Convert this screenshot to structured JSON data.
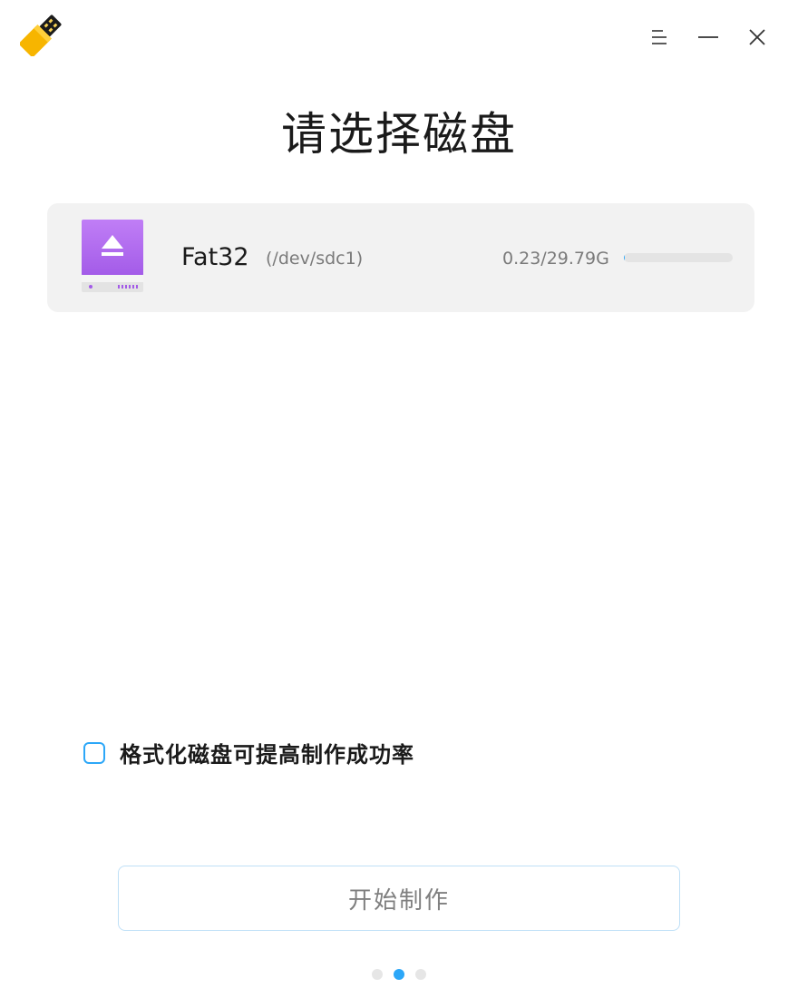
{
  "window": {
    "controls": {
      "menu_icon": "menu-icon",
      "minimize_icon": "minimize-icon",
      "close_icon": "close-icon"
    }
  },
  "page": {
    "title": "请选择磁盘"
  },
  "disks": [
    {
      "name": "Fat32",
      "path": "(/dev/sdc1)",
      "size": "0.23/29.79G",
      "usage_fraction": 0.0077
    }
  ],
  "options": {
    "format_label": "格式化磁盘可提高制作成功率",
    "format_checked": false
  },
  "actions": {
    "start_label": "开始制作"
  },
  "pager": {
    "total": 3,
    "current": 2
  },
  "colors": {
    "accent": "#2ca7f8",
    "disk_icon": "#b56ff2",
    "app_icon_yellow": "#f7b500"
  }
}
